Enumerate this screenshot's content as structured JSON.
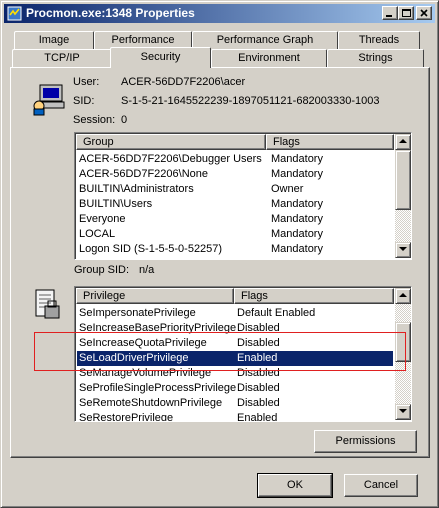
{
  "window": {
    "title": "Procmon.exe:1348 Properties"
  },
  "tabs": {
    "row_back": [
      "Image",
      "Performance",
      "Performance Graph",
      "Threads"
    ],
    "row_front": [
      "TCP/IP",
      "Security",
      "Environment",
      "Strings"
    ],
    "active": "Security"
  },
  "info": {
    "user_label": "User:",
    "user_value": "ACER-56DD7F2206\\acer",
    "sid_label": "SID:",
    "sid_value": "S-1-5-21-1645522239-1897051121-682003330-1003",
    "session_label": "Session:",
    "session_value": "0"
  },
  "groups": {
    "headers": [
      "Group",
      "Flags"
    ],
    "rows": [
      [
        "ACER-56DD7F2206\\Debugger Users",
        "Mandatory"
      ],
      [
        "ACER-56DD7F2206\\None",
        "Mandatory"
      ],
      [
        "BUILTIN\\Administrators",
        "Owner"
      ],
      [
        "BUILTIN\\Users",
        "Mandatory"
      ],
      [
        "Everyone",
        "Mandatory"
      ],
      [
        "LOCAL",
        "Mandatory"
      ],
      [
        "Logon SID (S-1-5-5-0-52257)",
        "Mandatory"
      ]
    ]
  },
  "group_sid": {
    "label": "Group SID:",
    "value": "n/a"
  },
  "privileges": {
    "headers": [
      "Privilege",
      "Flags"
    ],
    "rows": [
      [
        "SeImpersonatePrivilege",
        "Default Enabled"
      ],
      [
        "SeIncreaseBasePriorityPrivilege",
        "Disabled"
      ],
      [
        "SeIncreaseQuotaPrivilege",
        "Disabled"
      ],
      [
        "SeLoadDriverPrivilege",
        "Enabled"
      ],
      [
        "SeManageVolumePrivilege",
        "Disabled"
      ],
      [
        "SeProfileSingleProcessPrivilege",
        "Disabled"
      ],
      [
        "SeRemoteShutdownPrivilege",
        "Disabled"
      ],
      [
        "SeRestorePrivilege",
        "Enabled"
      ]
    ],
    "selected_index": 3
  },
  "buttons": {
    "permissions": "Permissions",
    "ok": "OK",
    "cancel": "Cancel"
  },
  "colors": {
    "selection": "#0a246a",
    "highlight_box": "#e02020",
    "face": "#d4d0c8"
  }
}
